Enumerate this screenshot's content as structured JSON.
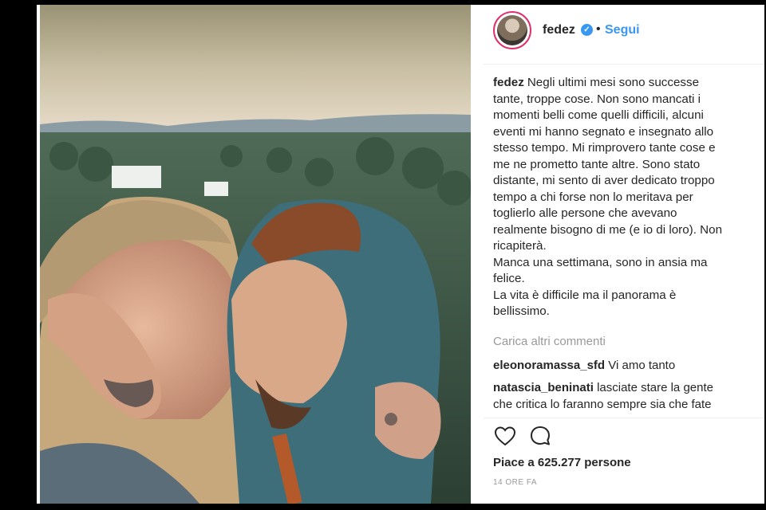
{
  "post": {
    "username": "fedez",
    "separator": "•",
    "follow_label": "Segui",
    "caption_user": "fedez",
    "caption_lines": [
      "Negli ultimi mesi sono successe",
      "tante, troppe cose. Non sono mancati i",
      "momenti belli come quelli difficili, alcuni",
      "eventi mi hanno segnato e insegnato allo",
      "stesso tempo. Mi rimprovero tante cose e",
      "me ne prometto tante altre. Sono stato",
      "distante, mi sento di aver dedicato troppo",
      "tempo a chi forse non lo meritava per",
      "toglierlo alle persone che avevano",
      "realmente bisogno di me (e io di loro). Non",
      "ricapiterà.",
      "Manca una settimana, sono in ansia ma",
      "felice.",
      "La vita è difficile ma il panorama è",
      "bellissimo."
    ],
    "load_more": "Carica altri commenti",
    "comments": [
      {
        "user": "eleonoramassa_sfd",
        "text": "Vi amo tanto"
      },
      {
        "user": "natascia_beninati",
        "text": "lasciate stare la gente",
        "text2": "che critica lo faranno sempre sia che fate"
      }
    ],
    "likes": "Piace a 625.277 persone",
    "time": "14 ORE FA"
  },
  "icons": {
    "verified": "verified-badge-icon",
    "like": "heart-icon",
    "comment": "speech-bubble-icon"
  },
  "colors": {
    "link": "#3897f0",
    "text": "#262626",
    "muted": "#999999"
  }
}
